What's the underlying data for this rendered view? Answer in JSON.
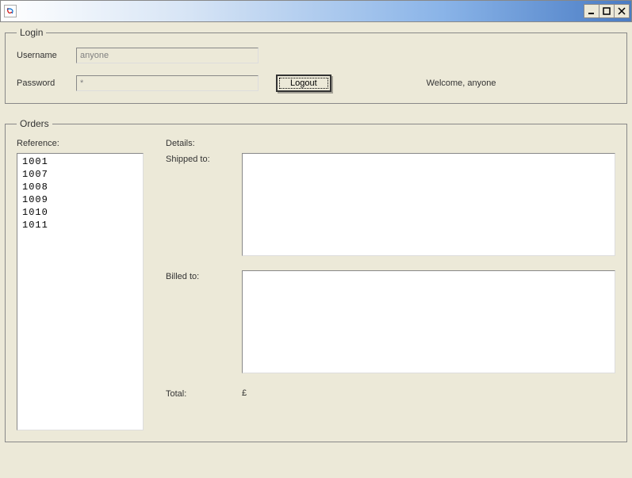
{
  "titlebar": {
    "title": ""
  },
  "login": {
    "legend": "Login",
    "username_label": "Username",
    "username_value": "anyone",
    "password_label": "Password",
    "password_value": "*",
    "logout_label": "Logout",
    "welcome_text": "Welcome, anyone"
  },
  "orders": {
    "legend": "Orders",
    "reference_label": "Reference:",
    "details_label": "Details:",
    "shipped_label": "Shipped to:",
    "shipped_value": "",
    "billed_label": "Billed to:",
    "billed_value": "",
    "total_label": "Total:",
    "total_currency": "£",
    "total_value": "",
    "references": [
      "1001",
      "1007",
      "1008",
      "1009",
      "1010",
      "1011"
    ]
  }
}
